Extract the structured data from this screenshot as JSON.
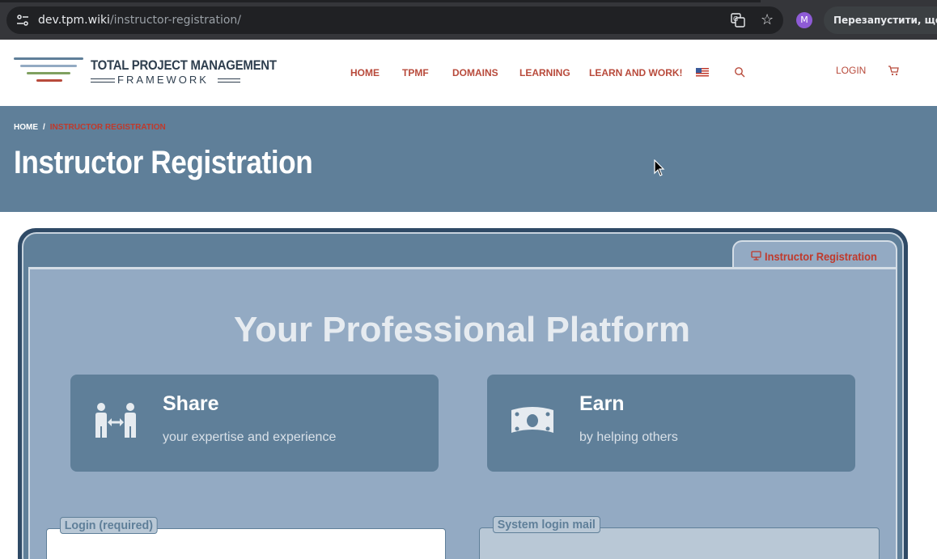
{
  "browser": {
    "url_host": "dev.tpm.wiki",
    "url_path": "/instructor-registration/",
    "profile_initial": "M",
    "restart_label": "Перезапустити, щоб он"
  },
  "header": {
    "logo_line1": "TOTAL PROJECT MANAGEMENT",
    "logo_line2": "FRAMEWORK",
    "nav": [
      "HOME",
      "TPMF",
      "DOMAINS",
      "LEARNING",
      "LEARN AND WORK!"
    ],
    "login": "LOGIN",
    "icons": {
      "flag": "us-flag-icon",
      "search": "search-icon",
      "cart": "cart-icon"
    }
  },
  "title_band": {
    "breadcrumb_home": "HOME",
    "breadcrumb_sep": "/",
    "breadcrumb_current": "INSTRUCTOR REGISTRATION",
    "title": "Instructor Registration"
  },
  "main": {
    "tab_label": "Instructor Registration",
    "heading": "Your Professional Platform",
    "features": [
      {
        "heading": "Share",
        "sub": "your expertise and experience",
        "icon": "people-exchange-icon"
      },
      {
        "heading": "Earn",
        "sub": "by helping others",
        "icon": "money-bill-icon"
      }
    ],
    "fields": [
      {
        "label": "Login (required)"
      },
      {
        "label": "System login mail"
      }
    ]
  },
  "colors": {
    "accent_red": "#b84a3b",
    "band_blue": "#5f7f99",
    "panel_blue": "#93aac3",
    "frame_dark": "#2f4a66"
  }
}
